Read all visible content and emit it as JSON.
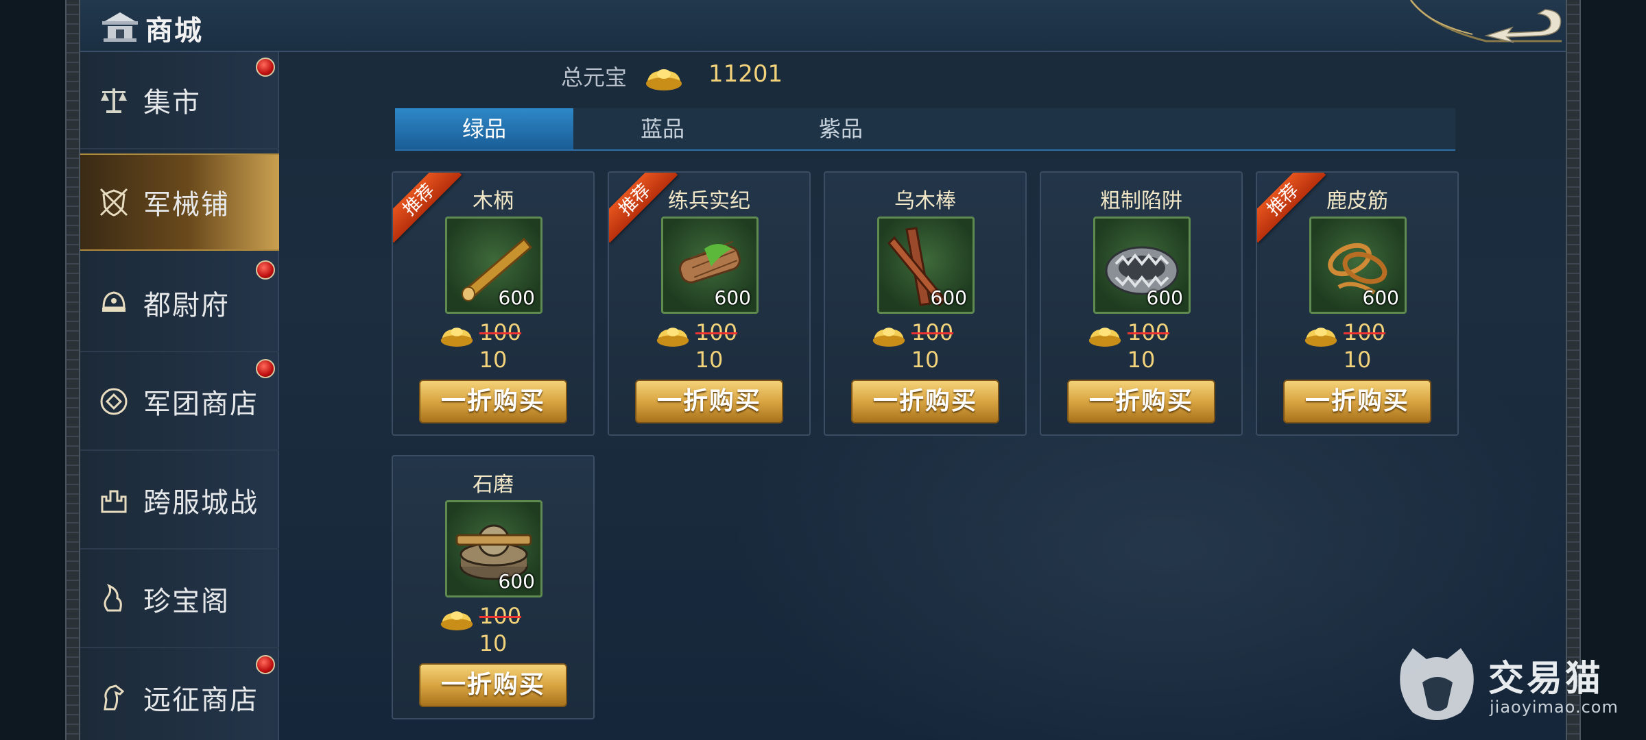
{
  "header": {
    "title": "商城"
  },
  "sidebar": {
    "items": [
      {
        "label": "集市",
        "icon": "scale-icon",
        "badge": true
      },
      {
        "label": "军械铺",
        "icon": "shield-swords-icon",
        "badge": false,
        "active": true
      },
      {
        "label": "都尉府",
        "icon": "helmet-icon",
        "badge": true
      },
      {
        "label": "军团商店",
        "icon": "coin-icon",
        "badge": true
      },
      {
        "label": "跨服城战",
        "icon": "castle-icon",
        "badge": false
      },
      {
        "label": "珍宝阁",
        "icon": "treasure-icon",
        "badge": false
      },
      {
        "label": "远征商店",
        "icon": "horse-icon",
        "badge": true
      }
    ]
  },
  "currency": {
    "label": "总元宝",
    "value": "11201"
  },
  "tabs": [
    {
      "label": "绿品",
      "active": true
    },
    {
      "label": "蓝品",
      "active": false
    },
    {
      "label": "紫品",
      "active": false
    }
  ],
  "items": [
    {
      "name": "木柄",
      "count": "600",
      "orig_price": "100",
      "price": "10",
      "button": "一折购买",
      "tag": "推荐",
      "icon": "wooden-handle-icon"
    },
    {
      "name": "练兵实纪",
      "count": "600",
      "orig_price": "100",
      "price": "10",
      "button": "一折购买",
      "tag": "推荐",
      "icon": "scroll-icon"
    },
    {
      "name": "乌木棒",
      "count": "600",
      "orig_price": "100",
      "price": "10",
      "button": "一折购买",
      "tag": "",
      "icon": "ebony-stick-icon"
    },
    {
      "name": "粗制陷阱",
      "count": "600",
      "orig_price": "100",
      "price": "10",
      "button": "一折购买",
      "tag": "",
      "icon": "trap-icon"
    },
    {
      "name": "鹿皮筋",
      "count": "600",
      "orig_price": "100",
      "price": "10",
      "button": "一折购买",
      "tag": "推荐",
      "icon": "rope-icon"
    },
    {
      "name": "石磨",
      "count": "600",
      "orig_price": "100",
      "price": "10",
      "button": "一折购买",
      "tag": "",
      "icon": "millstone-icon"
    }
  ],
  "watermark": {
    "name": "交易猫",
    "url": "jiaoyimao.com"
  },
  "colors": {
    "gold": "#f2d27a",
    "tab_active": "#2e88c8",
    "badge_red": "#c01010"
  }
}
